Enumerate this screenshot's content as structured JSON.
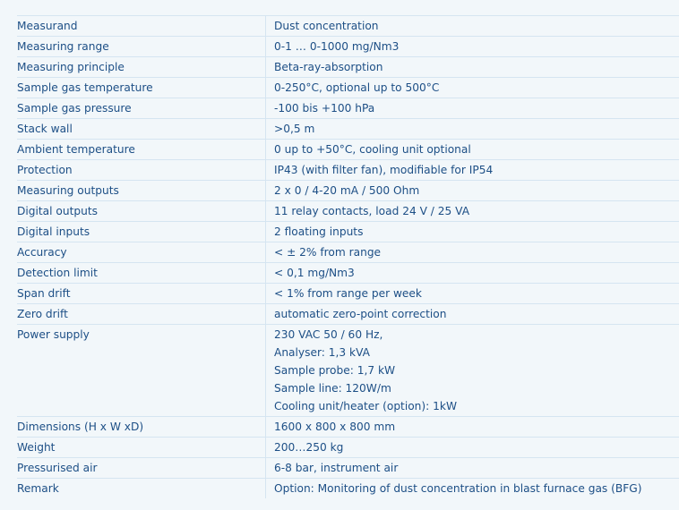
{
  "specs": [
    {
      "label": "Measurand",
      "value": [
        "Dust concentration"
      ]
    },
    {
      "label": "Measuring range",
      "value": [
        "0-1 … 0-1000 mg/Nm3"
      ]
    },
    {
      "label": "Measuring principle",
      "value": [
        "Beta-ray-absorption"
      ]
    },
    {
      "label": "Sample gas temperature",
      "value": [
        "0-250°C, optional up to 500°C"
      ]
    },
    {
      "label": "Sample gas pressure",
      "value": [
        "-100 bis +100 hPa"
      ]
    },
    {
      "label": "Stack wall",
      "value": [
        ">0,5 m"
      ]
    },
    {
      "label": "Ambient temperature",
      "value": [
        "0 up to +50°C, cooling unit optional"
      ]
    },
    {
      "label": "Protection",
      "value": [
        "IP43 (with filter fan), modifiable for IP54"
      ]
    },
    {
      "label": "Measuring outputs",
      "value": [
        "2 x 0 / 4-20 mA / 500 Ohm"
      ]
    },
    {
      "label": "Digital outputs",
      "value": [
        "11 relay contacts, load 24 V / 25 VA"
      ]
    },
    {
      "label": "Digital inputs",
      "value": [
        "2 floating inputs"
      ]
    },
    {
      "label": "Accuracy",
      "value": [
        "< ± 2% from range"
      ]
    },
    {
      "label": "Detection limit",
      "value": [
        "< 0,1 mg/Nm3"
      ]
    },
    {
      "label": "Span drift",
      "value": [
        "< 1% from range per week"
      ]
    },
    {
      "label": "Zero drift",
      "value": [
        "automatic zero-point correction"
      ]
    },
    {
      "label": "Power supply",
      "value": [
        "230 VAC 50 / 60 Hz,",
        "Analyser: 1,3 kVA",
        "Sample probe: 1,7 kW",
        "Sample line: 120W/m",
        "Cooling unit/heater (option): 1kW"
      ]
    },
    {
      "label": "Dimensions (H x W xD)",
      "value": [
        "1600 x 800 x 800 mm"
      ]
    },
    {
      "label": "Weight",
      "value": [
        "200…250 kg"
      ]
    },
    {
      "label": "Pressurised air",
      "value": [
        "6-8 bar, instrument air"
      ]
    },
    {
      "label": "Remark",
      "value": [
        "Option: Monitoring of dust concentration in blast furnace gas (BFG)"
      ]
    }
  ]
}
